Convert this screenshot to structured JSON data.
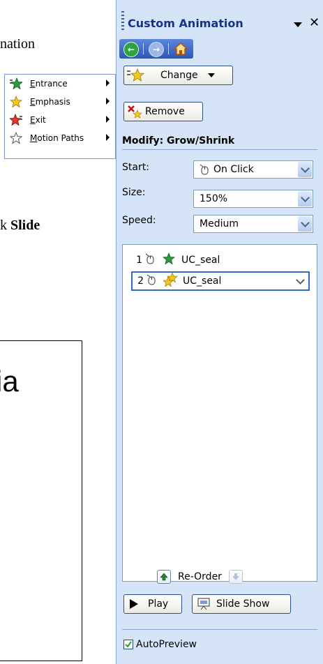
{
  "document": {
    "text_top": "nation",
    "text_mid_prefix": "k",
    "text_mid_bold": "Slide",
    "slide_text": "ia"
  },
  "menu": {
    "items": [
      {
        "label": "Entrance",
        "icon": "entrance-star-icon"
      },
      {
        "label": "Emphasis",
        "icon": "emphasis-star-icon"
      },
      {
        "label": "Exit",
        "icon": "exit-star-icon"
      },
      {
        "label": "Motion Paths",
        "icon": "motion-path-star-icon"
      }
    ]
  },
  "pane": {
    "title": "Custom Animation",
    "change_label": "Change",
    "remove_label": "Remove",
    "modify_title": "Modify: Grow/Shrink",
    "start_label": "Start:",
    "start_value": "On Click",
    "size_label": "Size:",
    "size_value": "150%",
    "speed_label": "Speed:",
    "speed_value": "Medium",
    "list": [
      {
        "num": "1",
        "name": "UC_seal"
      },
      {
        "num": "2",
        "name": "UC_seal"
      }
    ],
    "reorder_label": "Re-Order",
    "play_label": "Play",
    "slideshow_label": "Slide Show",
    "autopreview_label": "AutoPreview",
    "autopreview_checked": true
  },
  "colors": {
    "pane_bg": "#d6e4f7",
    "title_text": "#16328a",
    "nav_bar": "#2d58b5",
    "selection_border": "#316ac5"
  }
}
